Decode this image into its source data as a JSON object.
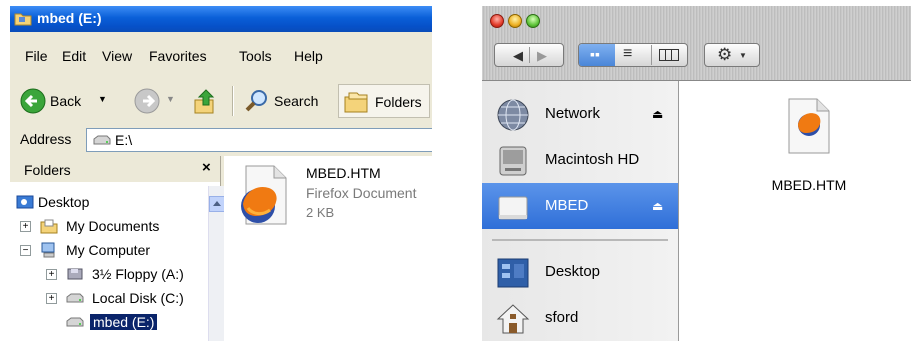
{
  "xp": {
    "title": "mbed (E:)",
    "menu": [
      "File",
      "Edit",
      "View",
      "Favorites",
      "Tools",
      "Help"
    ],
    "toolbar": {
      "back": "Back",
      "search": "Search",
      "folders": "Folders"
    },
    "address": {
      "label": "Address",
      "value": "E:\\"
    },
    "folders_pane": {
      "title": "Folders",
      "close": "×",
      "tree": [
        {
          "label": "Desktop"
        },
        {
          "label": "My Documents",
          "expander": "+"
        },
        {
          "label": "My Computer",
          "expander": "−"
        },
        {
          "label": "3½ Floppy (A:)",
          "expander": "+"
        },
        {
          "label": "Local Disk (C:)",
          "expander": "+"
        },
        {
          "label": "mbed (E:)"
        }
      ]
    },
    "file": {
      "name": "MBED.HTM",
      "type": "Firefox Document",
      "size": "2 KB"
    }
  },
  "mac": {
    "sidebar": [
      {
        "label": "Network",
        "eject": "⏏"
      },
      {
        "label": "Macintosh HD"
      },
      {
        "label": "MBED",
        "eject": "⏏"
      },
      {
        "label": "Desktop"
      },
      {
        "label": "sford"
      }
    ],
    "file": {
      "name": "MBED.HTM"
    }
  },
  "colors": {
    "xp_title_blue": "#0a5fd8",
    "xp_selection": "#0a246a",
    "mac_selection": "#3a78de"
  }
}
